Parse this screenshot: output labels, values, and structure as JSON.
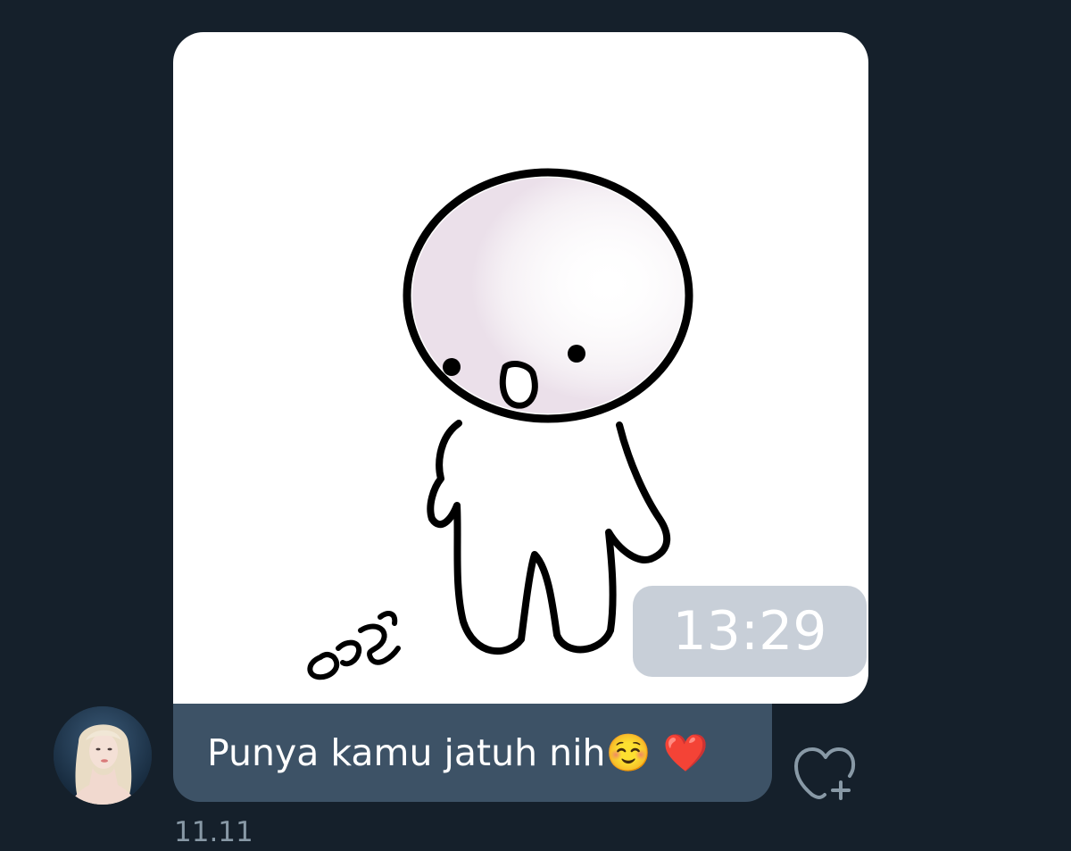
{
  "conversation": {
    "messages": [
      {
        "type": "sticker",
        "sticker_name": "sad-blob-dropped-item",
        "time_overlay": "13:29"
      },
      {
        "type": "text",
        "text": "Punya kamu jatuh nih☺️ ❤️",
        "sent_time": "11.11"
      }
    ],
    "react_icon": "heart-plus-icon",
    "avatar_icon": "user-avatar"
  },
  "colors": {
    "background": "#15202b",
    "bubble": "#3d5266",
    "timestamp_pill": "#c8cfd8",
    "muted_text": "#8899a6"
  }
}
